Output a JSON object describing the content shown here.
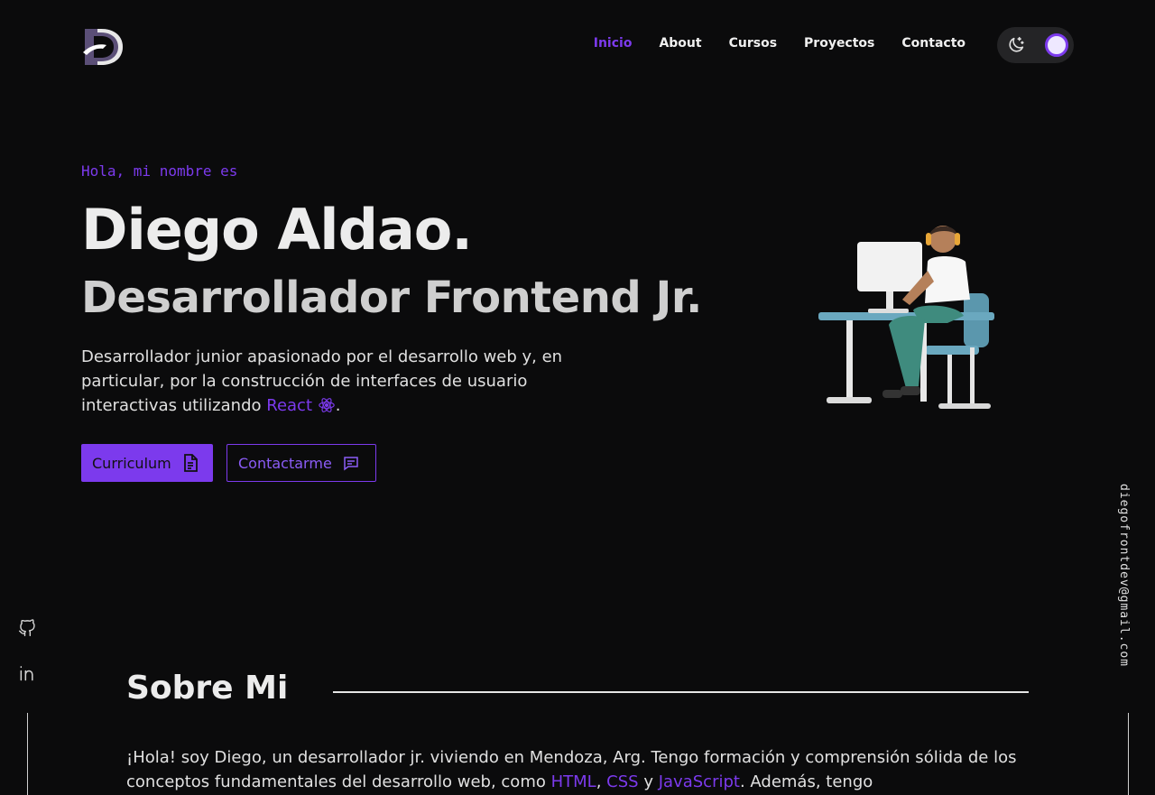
{
  "header": {
    "logo_letter": "D",
    "nav": [
      "Inicio",
      "About",
      "Cursos",
      "Proyectos",
      "Contacto"
    ],
    "active_nav": "Inicio",
    "theme_icon": "moon-icon"
  },
  "hero": {
    "greeting": "Hola, mi nombre es",
    "name": "Diego Aldao.",
    "role": "Desarrollador Frontend Jr.",
    "intro_line": "Desarrollador junior apasionado por el desarrollo web y, en particular, por la construcción de interfaces de usuario interactivas utilizando",
    "intro_tech": "React",
    "intro_end": ".",
    "cv_button": "Curriculum",
    "contact_button": "Contactarme"
  },
  "socials": {
    "github_icon": "github-icon",
    "linkedin_icon": "linkedin-icon",
    "email": "diegofrontdev@gmail.com"
  },
  "about": {
    "title": "Sobre Mi",
    "text_start": "¡Hola! soy Diego, un desarrollador jr. viviendo en Mendoza, Arg. Tengo formación y comprensión sólida de los conceptos fundamentales del desarrollo web, como",
    "tech_html": "HTML",
    "comma": ",",
    "tech_css": "CSS",
    "and": "y",
    "tech_js": "JavaScript",
    "text_end": ". Además, tengo"
  },
  "colors": {
    "accent": "#7c3aed",
    "background": "#0b0b0c"
  }
}
